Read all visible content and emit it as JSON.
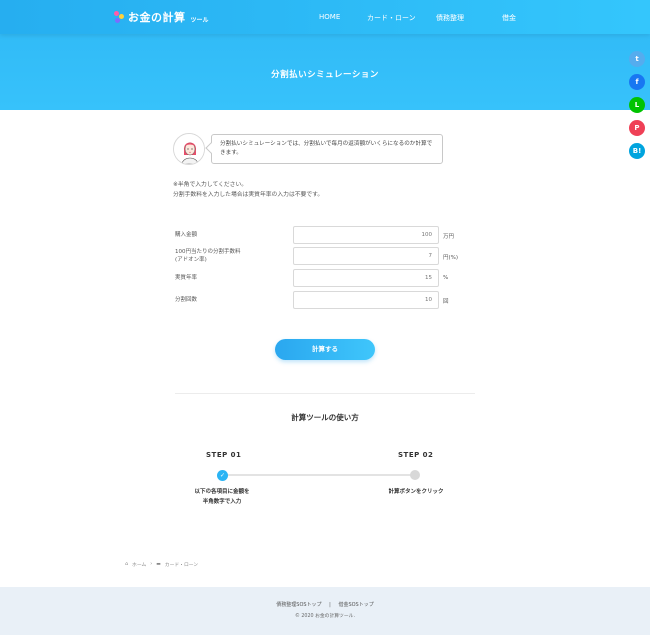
{
  "header": {
    "logo_text": "お金の計算",
    "logo_sub": "ツール",
    "nav": [
      {
        "label": "HOME"
      },
      {
        "label": "カード・ローン"
      },
      {
        "label": "債務整理"
      },
      {
        "label": "借金"
      }
    ],
    "hero_title": "分割払いシミュレーション"
  },
  "share": [
    {
      "icon": "twitter-icon",
      "glyph": "t",
      "color": "#55acee"
    },
    {
      "icon": "facebook-icon",
      "glyph": "f",
      "color": "#1877f2"
    },
    {
      "icon": "line-icon",
      "glyph": "L",
      "color": "#00c300"
    },
    {
      "icon": "pocket-icon",
      "glyph": "P",
      "color": "#ef4056"
    },
    {
      "icon": "hatena-icon",
      "glyph": "B!",
      "color": "#00a4de"
    }
  ],
  "intro": {
    "bubble_text": "分割払いシミュレーションでは、分割払いで毎月の返済額がいくらになるのか計算できます。",
    "note1": "※半角で入力してください。",
    "note2": "分割手数料を入力した場合は実質年率の入力は不要です。"
  },
  "form": {
    "rows": [
      {
        "label": "購入金額",
        "placeholder": "100",
        "unit": "万円"
      },
      {
        "label": "100円当たりの分割手数料\n(アドオン率)",
        "placeholder": "7",
        "unit": "円(%)"
      },
      {
        "label": "実質年率",
        "placeholder": "15",
        "unit": "%"
      },
      {
        "label": "分割回数",
        "placeholder": "10",
        "unit": "回"
      }
    ],
    "submit_label": "計算する"
  },
  "howto": {
    "title": "計算ツールの使い方",
    "steps": [
      {
        "label": "STEP 01",
        "desc": "以下の各項目に金額を\n半角数字で入力"
      },
      {
        "label": "STEP 02",
        "desc": "計算ボタンをクリック"
      }
    ]
  },
  "breadcrumb": {
    "home": "ホーム",
    "category": "カード・ローン"
  },
  "footer": {
    "links": [
      "債務整理SOSトップ",
      "借金SOSトップ"
    ],
    "copyright": "© 2020 お金の計算ツール."
  }
}
